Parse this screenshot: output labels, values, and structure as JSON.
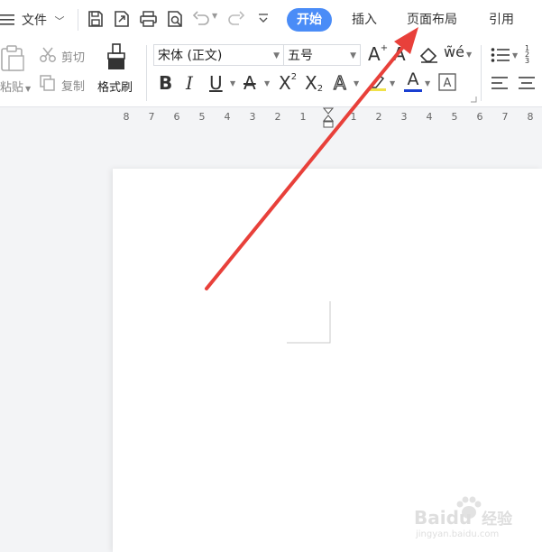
{
  "quickbar": {
    "file_label": "文件"
  },
  "tabs": [
    {
      "label": "开始",
      "active": true
    },
    {
      "label": "插入",
      "active": false
    },
    {
      "label": "页面布局",
      "active": false
    },
    {
      "label": "引用",
      "active": false
    }
  ],
  "clipboard": {
    "paste_label": "粘贴",
    "cut_label": "剪切",
    "copy_label": "复制",
    "format_painter_label": "格式刷"
  },
  "font": {
    "name": "宋体 (正文)",
    "size": "五号"
  },
  "ruler": {
    "ticks": [
      "8",
      "7",
      "6",
      "5",
      "4",
      "3",
      "2",
      "1",
      "",
      "1",
      "2",
      "3",
      "4",
      "5",
      "6",
      "7",
      "8"
    ]
  },
  "watermark": {
    "brand": "Baidu",
    "tagline": "经验",
    "url": "jingyan.baidu.com"
  },
  "colors": {
    "accent": "#4a8cf7",
    "annotation_arrow": "#e8403a",
    "font_color_bar": "#1a3fd1"
  }
}
